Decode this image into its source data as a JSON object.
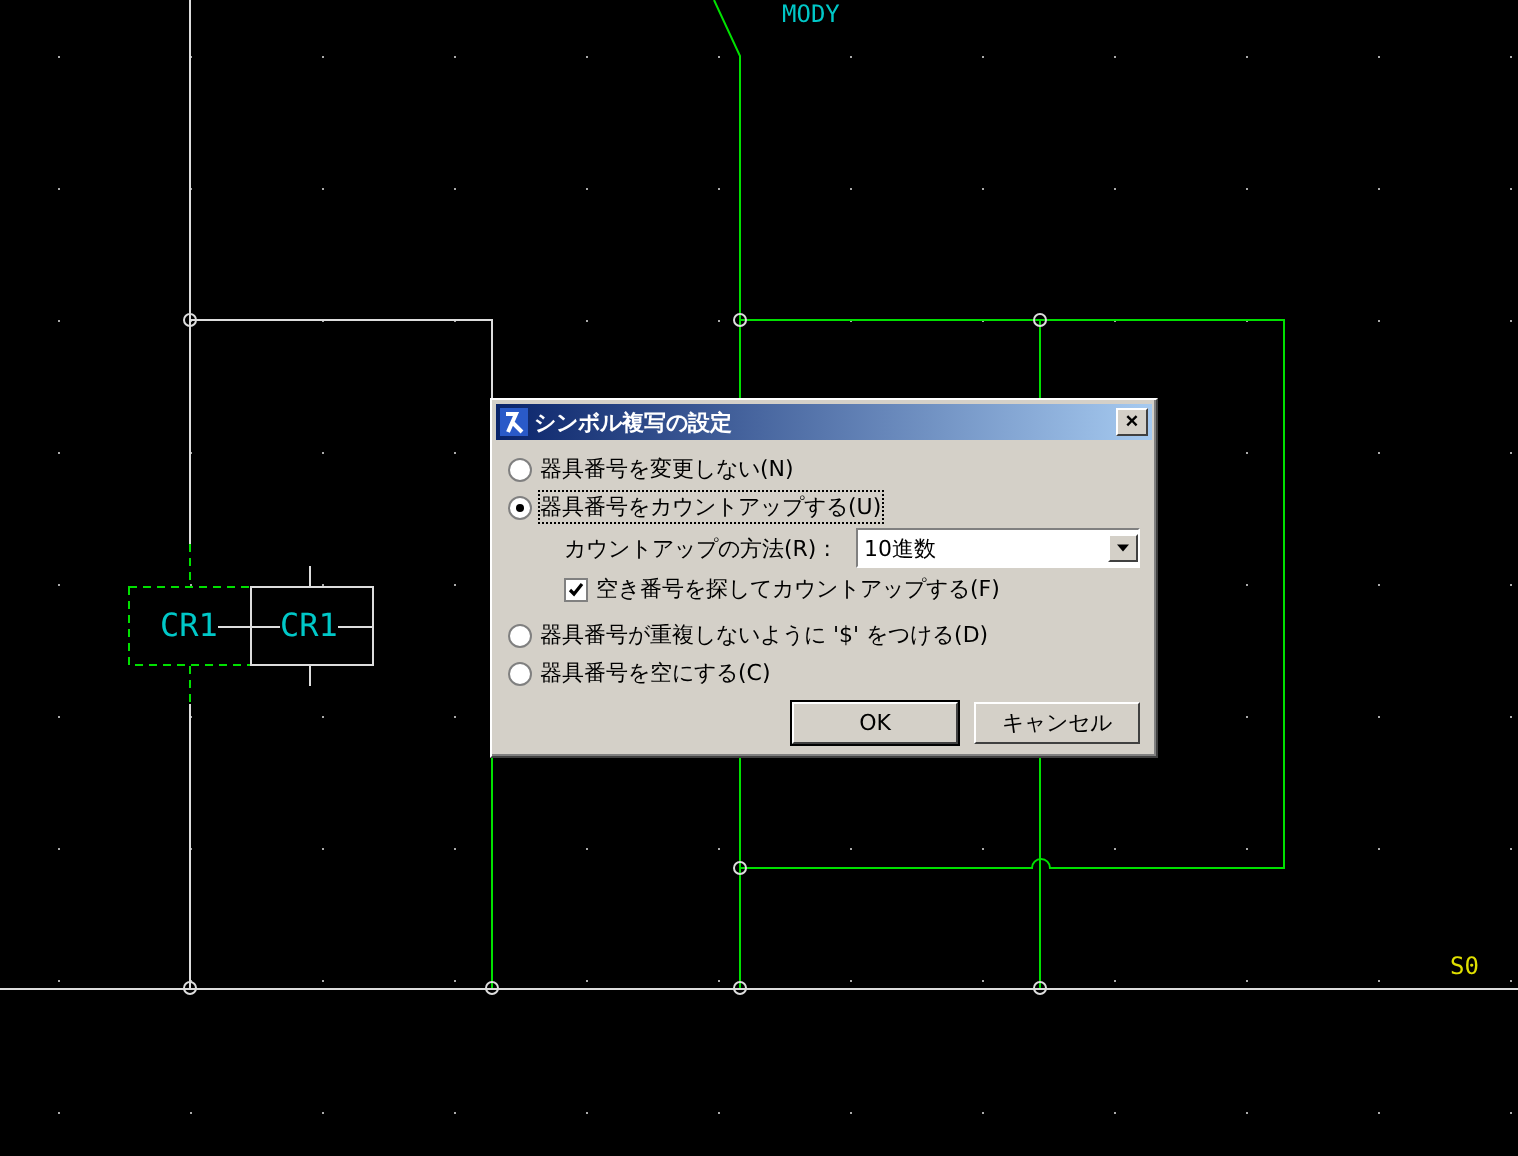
{
  "canvas": {
    "labels": [
      {
        "text": "MODY",
        "kind": "net"
      },
      {
        "text": "CR1",
        "kind": "ghost"
      },
      {
        "text": "CR1",
        "kind": "part"
      },
      {
        "text": "S0",
        "kind": "signal"
      }
    ]
  },
  "dialog": {
    "title": "シンボル複写の設定",
    "close": "×",
    "options": [
      {
        "label": "器具番号を変更しない(N)",
        "selected": false
      },
      {
        "label": "器具番号をカウントアップする(U)",
        "selected": true
      },
      {
        "label": "器具番号が重複しないように '$' をつける(D)",
        "selected": false
      },
      {
        "label": "器具番号を空にする(C)",
        "selected": false
      }
    ],
    "method": {
      "label": "カウントアップの方法(R) :",
      "value": "10進数"
    },
    "find_empty": {
      "label": "空き番号を探してカウントアップする(F)",
      "checked": true
    },
    "buttons": [
      "OK",
      "キャンセル"
    ]
  }
}
